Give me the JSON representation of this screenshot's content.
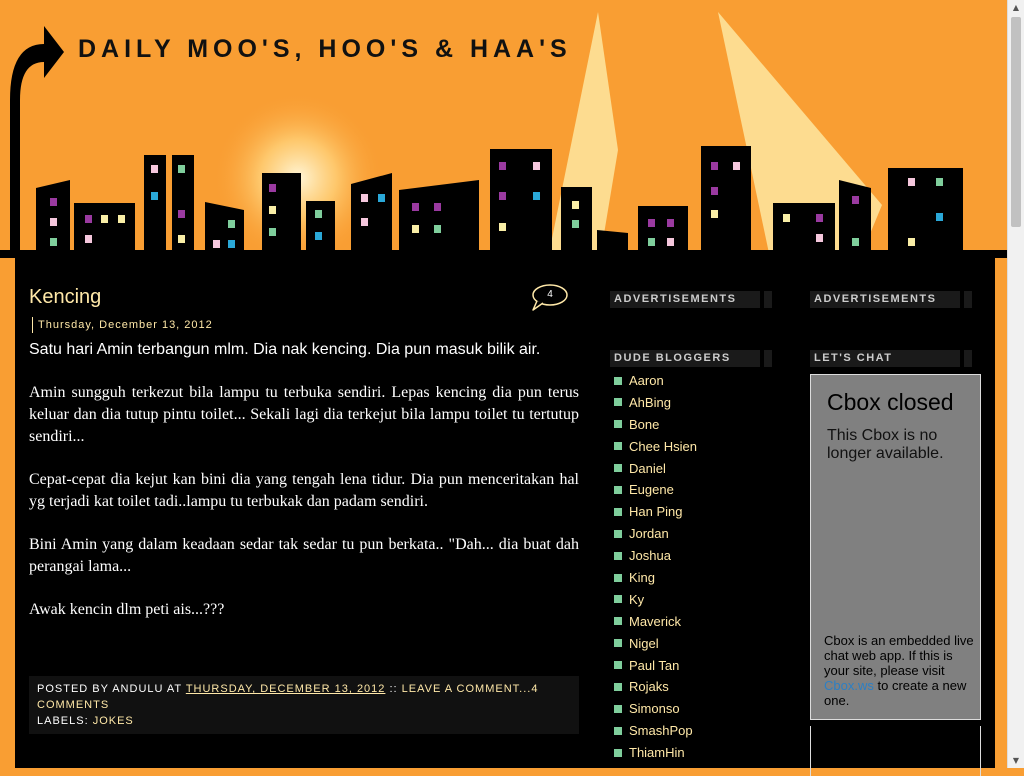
{
  "header": {
    "title": "DAILY MOO'S, HOO'S & HAA'S"
  },
  "post": {
    "title": "Kencing",
    "comment_count": "4",
    "date": "Thursday, December 13, 2012",
    "paragraphs": [
      "Satu hari Amin terbangun mlm. Dia nak kencing. Dia pun masuk bilik air.",
      "Amin sungguh terkezut bila lampu tu terbuka sendiri. Lepas kencing dia pun terus keluar dan dia tutup pintu toilet... Sekali lagi dia terkejut bila lampu toilet tu tertutup sendiri...",
      "Cepat-cepat dia kejut kan bini dia yang tengah lena tidur. Dia pun menceritakan hal yg terjadi kat toilet tadi..lampu tu terbukak dan padam sendiri.",
      "Bini Amin yang dalam keadaan sedar tak sedar tu pun berkata.. \"Dah... dia buat dah perangai lama...",
      "Awak kencin dlm peti ais...???"
    ],
    "footer": {
      "posted_by_prefix": "POSTED BY",
      "author": "ANDULU",
      "at": "AT",
      "datetime": "THURSDAY, DECEMBER 13, 2012",
      "separator": "::",
      "comment_link": "LEAVE A COMMENT...4 COMMENTS",
      "labels_prefix": "LABELS:",
      "label": "JOKES"
    }
  },
  "sidebar_left": {
    "ads_heading": "ADVERTISEMENTS",
    "bloggers_heading": "DUDE BLOGGERS",
    "bloggers": [
      "Aaron",
      "AhBing",
      "Bone",
      "Chee Hsien",
      "Daniel",
      "Eugene",
      "Han Ping",
      "Jordan",
      "Joshua",
      "King",
      "Ky",
      "Maverick",
      "Nigel",
      "Paul Tan",
      "Rojaks",
      "Simonso",
      "SmashPop",
      "ThiamHin"
    ]
  },
  "sidebar_right": {
    "ads_heading": "ADVERTISEMENTS",
    "chat_heading": "LET'S CHAT",
    "cbox": {
      "title": "Cbox closed",
      "subtitle": "This Cbox is no longer available.",
      "info_before": "Cbox is an embedded live chat web app. If this is your site, please visit",
      "info_link": "Cbox.ws",
      "info_after": "to create a new one."
    }
  },
  "colors": {
    "background": "#f99e33",
    "content_bg": "#000000",
    "accent_text": "#ffe8a8",
    "bullet": "#7fce9c"
  }
}
